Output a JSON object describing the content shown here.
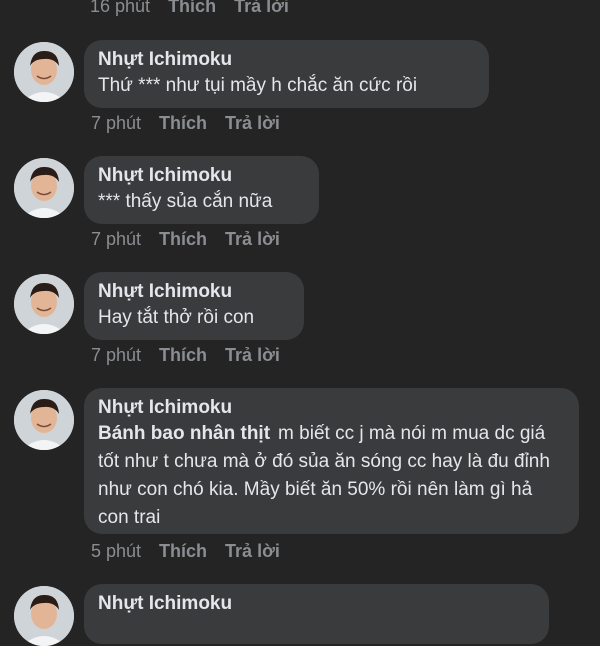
{
  "top_meta": {
    "time": "16 phút",
    "like": "Thích",
    "reply": "Trả lời"
  },
  "comments": [
    {
      "author": "Nhựt Ichimoku",
      "text": "Thứ *** như tụi mầy h chắc ăn cức rồi",
      "time": "7 phút",
      "like": "Thích",
      "reply": "Trả lời"
    },
    {
      "author": "Nhựt Ichimoku",
      "text": "*** thấy sủa cắn nữa",
      "time": "7 phút",
      "like": "Thích",
      "reply": "Trả lời"
    },
    {
      "author": "Nhựt Ichimoku",
      "text": "Hay tắt thở rồi con",
      "time": "7 phút",
      "like": "Thích",
      "reply": "Trả lời"
    },
    {
      "author": "Nhựt Ichimoku",
      "mention": "Bánh bao nhân thịt",
      "text": "m biết cc j mà nói m mua dc giá tốt như t chưa mà ở đó sủa ăn sóng cc hay là đu đỉnh như con chó kia. Mầy biết ăn 50% rồi nên làm gì hả con trai",
      "time": "5 phút",
      "like": "Thích",
      "reply": "Trả lời"
    },
    {
      "author": "Nhựt Ichimoku"
    }
  ],
  "colors": {
    "background": "#242424",
    "bubble": "#3a3b3c",
    "text": "#e4e6eb",
    "muted": "#8a8d91"
  }
}
